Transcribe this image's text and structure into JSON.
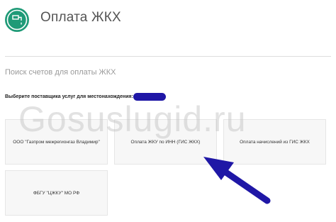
{
  "header": {
    "title": "Оплата ЖКХ",
    "logo_icon": "faucet-icon",
    "logo_color": "#1f9a77"
  },
  "search": {
    "title": "Поиск счетов для оплаты ЖКХ",
    "select_label": "Выберите поставщика услуг для местонахождения:"
  },
  "providers": [
    {
      "label": "ООО \"Газпром межрегионгаз Владимир\""
    },
    {
      "label": "Оплата ЖКУ по ИНН (ГИС ЖКХ)"
    },
    {
      "label": "Оплата начислений из ГИС ЖКХ"
    },
    {
      "label": "ФБГУ \"ЦЖКУ\" МО РФ"
    }
  ],
  "watermark": "Gosuslugid.ru",
  "annotation_color": "#1f17a6"
}
